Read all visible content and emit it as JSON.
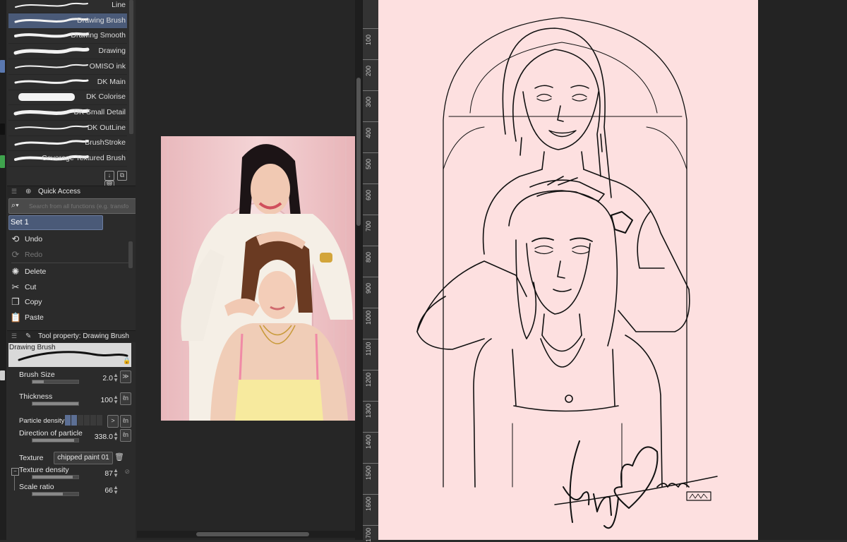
{
  "brush_list": {
    "items": [
      {
        "label": "Line",
        "selected": false
      },
      {
        "label": "Drawing Brush",
        "selected": true
      },
      {
        "label": "Drawing Smooth",
        "selected": false
      },
      {
        "label": "Drawing",
        "selected": false
      },
      {
        "label": "OMISO ink",
        "selected": false
      },
      {
        "label": "DK Main",
        "selected": false
      },
      {
        "label": "DK Colorise",
        "selected": false
      },
      {
        "label": "DK Small Detail",
        "selected": false
      },
      {
        "label": "DK OutLine",
        "selected": false
      },
      {
        "label": "BrushStroke",
        "selected": false
      },
      {
        "label": "Coverage Textured Brush",
        "selected": false
      }
    ]
  },
  "quick_access": {
    "title": "Quick Access",
    "search_placeholder": "Search from all functions (e.g. transfo",
    "set_label": "Set 1",
    "items": [
      {
        "label": "Undo",
        "icon": "undo-icon",
        "enabled": true
      },
      {
        "label": "Redo",
        "icon": "redo-icon",
        "enabled": false
      },
      {
        "label": "Delete",
        "icon": "delete-icon",
        "enabled": true
      },
      {
        "label": "Cut",
        "icon": "scissors-icon",
        "enabled": true
      },
      {
        "label": "Copy",
        "icon": "copy-icon",
        "enabled": true
      },
      {
        "label": "Paste",
        "icon": "paste-icon",
        "enabled": true
      }
    ]
  },
  "tool_property": {
    "title": "Tool property: Drawing Brush",
    "preview_label": "Drawing Brush",
    "brush_size": {
      "label": "Brush Size",
      "value": "2.0"
    },
    "thickness": {
      "label": "Thickness",
      "value": "100"
    },
    "particle_density": {
      "label": "Particle density"
    },
    "direction": {
      "label": "Direction of particle",
      "value": "338.0"
    },
    "texture": {
      "label": "Texture",
      "value": "chipped paint 01"
    },
    "texture_density": {
      "label": "Texture density",
      "value": "87"
    },
    "scale_ratio": {
      "label": "Scale ratio",
      "value": "66"
    }
  },
  "ruler": {
    "ticks": [
      "100",
      "200",
      "300",
      "400",
      "500",
      "600",
      "700",
      "800",
      "900",
      "1000",
      "1100",
      "1200",
      "1300",
      "1400",
      "1500",
      "1600",
      "1700"
    ]
  },
  "colors": {
    "selection": "#4a5a78",
    "canvas_pink": "#fde0e0",
    "panel_bg": "#2d2d2d"
  }
}
